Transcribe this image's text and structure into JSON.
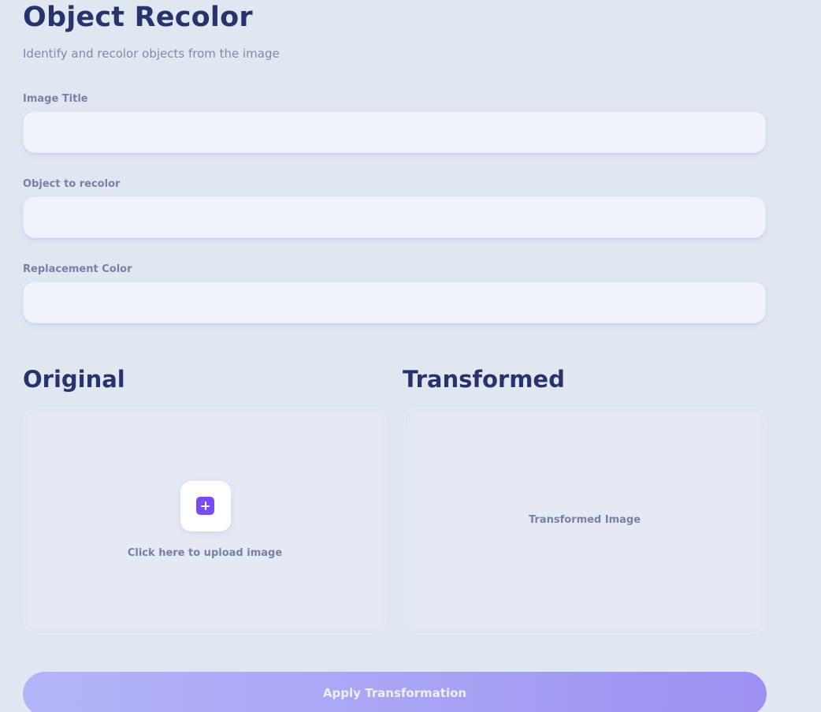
{
  "header": {
    "title": "Object Recolor",
    "subtitle": "Identify and recolor objects from the image"
  },
  "form": {
    "image_title": {
      "label": "Image Title",
      "value": "",
      "placeholder": ""
    },
    "object_to_recolor": {
      "label": "Object to recolor",
      "value": "",
      "placeholder": ""
    },
    "replacement_color": {
      "label": "Replacement Color",
      "value": "",
      "placeholder": ""
    }
  },
  "original": {
    "heading": "Original",
    "upload_icon": "plus-icon",
    "upload_text": "Click here to upload image"
  },
  "transformed": {
    "heading": "Transformed",
    "placeholder_text": "Transformed Image"
  },
  "actions": {
    "apply_label": "Apply Transformation"
  },
  "colors": {
    "background": "#e1e7f0",
    "heading": "#27336b",
    "accent": "#7a4cf3",
    "button_gradient_start": "#b3b5f7",
    "button_gradient_end": "#9d90f2"
  }
}
